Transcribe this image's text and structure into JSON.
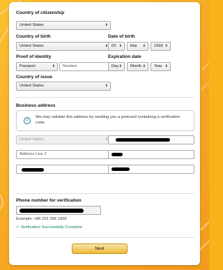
{
  "form": {
    "citizenship": {
      "label": "Country of citizenship",
      "value": "United States"
    },
    "birth_country": {
      "label": "Country of birth",
      "value": "United States"
    },
    "dob": {
      "label": "Date of birth",
      "day": "03",
      "month": "Mar",
      "year": "1993"
    },
    "proof": {
      "label": "Proof of identity",
      "type": "Passport",
      "number_placeholder": "Number"
    },
    "expiration": {
      "label": "Expiration date",
      "day": "Day",
      "month": "Month",
      "year": "Year"
    },
    "issue_country": {
      "label": "Country of issue",
      "value": "United States"
    }
  },
  "business": {
    "heading": "Business address",
    "info_text": "We may validate this address by sending you a postcard containing a verification code.",
    "country": "United States",
    "address2_placeholder": "Address Line 2"
  },
  "phone": {
    "label": "Phone number for verification",
    "example": "Example: +86 201 266 1000",
    "status": "Verification Successfully Complete"
  },
  "next_label": "Next",
  "colors": {
    "accent": "#f0c14b",
    "success": "#067d62",
    "info": "#007185"
  }
}
